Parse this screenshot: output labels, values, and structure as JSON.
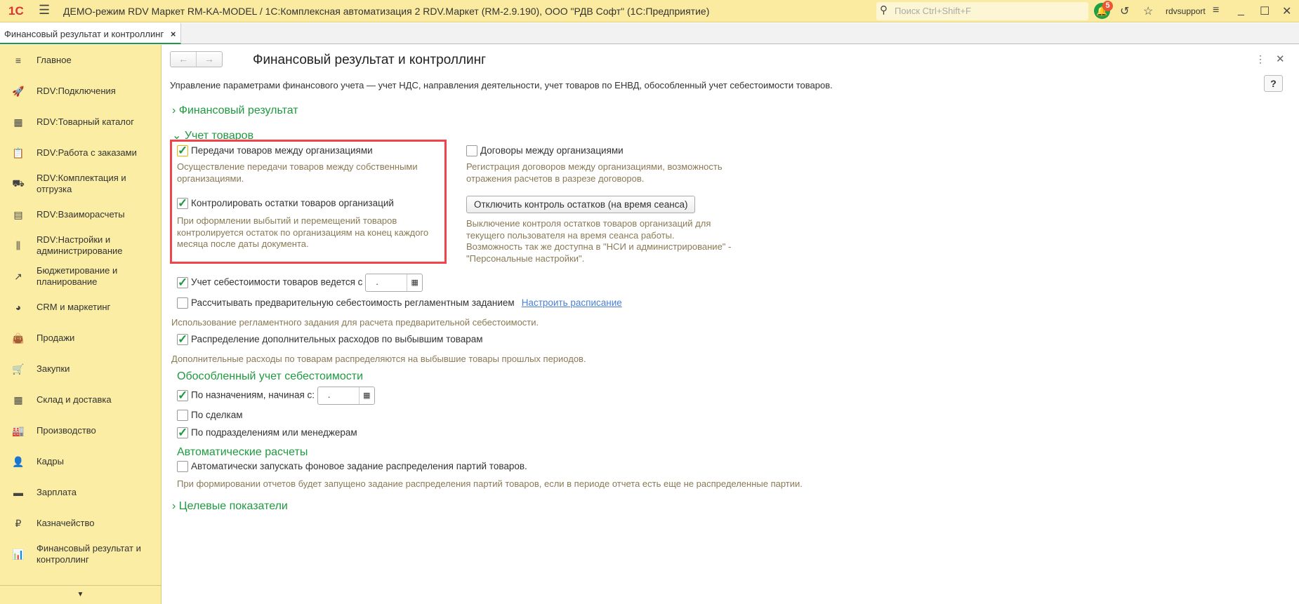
{
  "titlebar": {
    "logo": "1С",
    "title": "ДЕМО-режим RDV Маркет RM-KA-MODEL / 1С:Комплексная автоматизация 2 RDV.Маркет (RM-2.9.190), ООО \"РДВ Софт\"  (1С:Предприятие)",
    "search_placeholder": "Поиск Ctrl+Shift+F",
    "notifications": "5",
    "user": "rdvsupport"
  },
  "tab": {
    "label": "Финансовый результат и контроллинг",
    "close": "×"
  },
  "sidebar": {
    "items": [
      {
        "label": "Главное",
        "icon": "≡"
      },
      {
        "label": "RDV:Подключения",
        "icon": "🚀"
      },
      {
        "label": "RDV:Товарный каталог",
        "icon": "▦"
      },
      {
        "label": "RDV:Работа с заказами",
        "icon": "📋"
      },
      {
        "label": "RDV:Комплектация и отгрузка",
        "icon": "⛟"
      },
      {
        "label": "RDV:Взаиморасчеты",
        "icon": "▤"
      },
      {
        "label": "RDV:Настройки и администрирование",
        "icon": "⫼"
      },
      {
        "label": "Бюджетирование и планирование",
        "icon": "↗"
      },
      {
        "label": "CRM и маркетинг",
        "icon": "◕"
      },
      {
        "label": "Продажи",
        "icon": "👜"
      },
      {
        "label": "Закупки",
        "icon": "🛒"
      },
      {
        "label": "Склад и доставка",
        "icon": "▦"
      },
      {
        "label": "Производство",
        "icon": "🏭"
      },
      {
        "label": "Кадры",
        "icon": "👤"
      },
      {
        "label": "Зарплата",
        "icon": "▬"
      },
      {
        "label": "Казначейство",
        "icon": "₽"
      },
      {
        "label": "Финансовый результат и контроллинг",
        "icon": "📊"
      }
    ]
  },
  "form": {
    "title": "Финансовый результат и контроллинг",
    "description": "Управление параметрами финансового учета — учет НДС, направления деятельности, учет товаров по ЕНВД, обособленный учет себестоимости товаров.",
    "help": "?",
    "group_fin": "Финансовый результат",
    "group_goods": "Учет товаров",
    "transfers": {
      "label": "Передачи товаров между организациями",
      "checked": true,
      "note": "Осуществление передачи товаров между собственными организациями."
    },
    "control": {
      "label": "Контролировать остатки товаров организаций",
      "checked": true,
      "note": "При оформлении выбытий и перемещений товаров контролируется остаток по организациям на конец каждого месяца после даты документа."
    },
    "contracts": {
      "label": "Договоры между организациями",
      "checked": false,
      "note": "Регистрация договоров между организациями, возможность отражения расчетов  в разрезе договоров."
    },
    "disable_btn": "Отключить контроль остатков (на время сеанса)",
    "disable_note": "Выключение контроля остатков товаров организаций для текущего пользователя на время сеанса работы.\n Возможность так же доступна в \"НСИ и администрирование\" - \"Персональные настройки\".",
    "cost_from": {
      "label": "Учет себестоимости товаров ведется с",
      "checked": true,
      "value": "."
    },
    "precalc": {
      "label": "Рассчитывать предварительную себестоимость регламентным заданием",
      "checked": false,
      "link": "Настроить расписание",
      "note": "Использование регламентного задания для расчета предварительной себестоимости."
    },
    "distrib": {
      "label": "Распределение дополнительных расходов по выбывшим товарам",
      "checked": true,
      "note": "Дополнительные расходы по товарам распределяются на выбывшие товары прошлых периодов."
    },
    "group_separate": "Обособленный учет себестоимости",
    "by_purpose": {
      "label": "По назначениям, начиная с:",
      "checked": true,
      "value": "."
    },
    "by_deals": {
      "label": "По сделкам",
      "checked": false
    },
    "by_depts": {
      "label": "По подразделениям или менеджерам",
      "checked": true
    },
    "group_auto": "Автоматические расчеты",
    "auto_run": {
      "label": "Автоматически запускать фоновое задание распределения партий товаров.",
      "checked": false,
      "note": "При формировании отчетов будет запущено задание распределения партий товаров, если в периоде отчета есть еще не распределенные партии."
    },
    "group_targets": "Целевые показатели"
  }
}
